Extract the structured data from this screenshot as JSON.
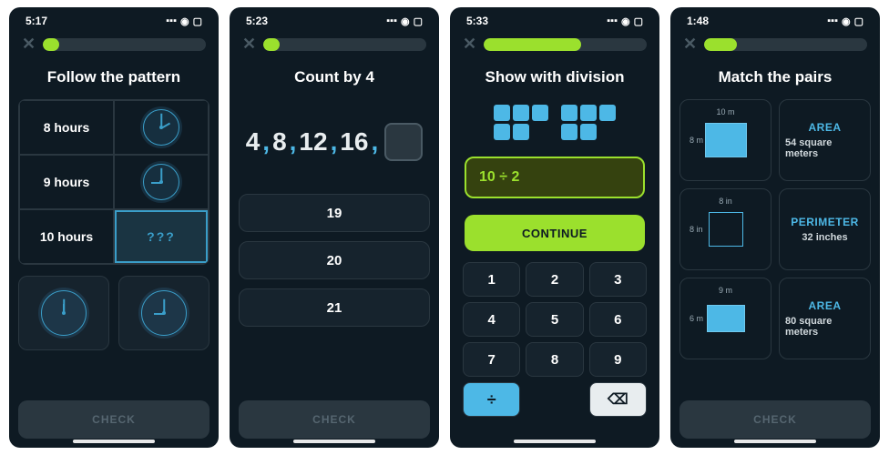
{
  "screens": [
    {
      "time": "5:17",
      "progress": 10,
      "title": "Follow the pattern",
      "rows": [
        "8 hours",
        "9 hours",
        "10 hours"
      ],
      "unknown": "???",
      "check": "CHECK"
    },
    {
      "time": "5:23",
      "progress": 10,
      "title": "Count by 4",
      "sequence": [
        "4",
        "8",
        "12",
        "16"
      ],
      "options": [
        "19",
        "20",
        "21"
      ],
      "check": "CHECK"
    },
    {
      "time": "5:33",
      "progress": 60,
      "title": "Show with division",
      "expression": "10 ÷ 2",
      "continue": "CONTINUE",
      "keys": [
        "1",
        "2",
        "3",
        "4",
        "5",
        "6",
        "7",
        "8",
        "9"
      ],
      "op": "÷",
      "del": "⌫"
    },
    {
      "time": "1:48",
      "progress": 20,
      "title": "Match the pairs",
      "shapes": [
        {
          "w": "10 m",
          "h": "8 m",
          "fill": true,
          "sw": 44,
          "sh": 36
        },
        {
          "w": "8 in",
          "h": "8 in",
          "fill": false,
          "sw": 36,
          "sh": 36
        },
        {
          "w": "9 m",
          "h": "6 m",
          "fill": true,
          "sw": 40,
          "sh": 28
        }
      ],
      "cards": [
        {
          "label": "AREA",
          "value": "54 square meters"
        },
        {
          "label": "PERIMETER",
          "value": "32 inches"
        },
        {
          "label": "AREA",
          "value": "80 square meters"
        }
      ],
      "check": "CHECK"
    }
  ]
}
